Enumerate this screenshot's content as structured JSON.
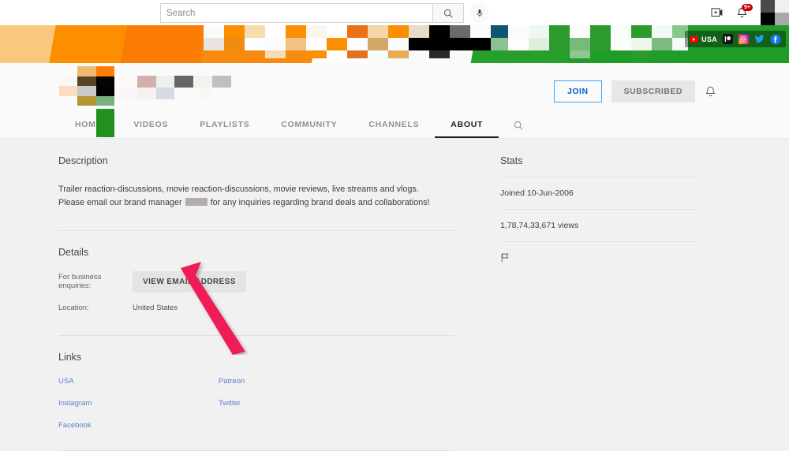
{
  "masthead": {
    "search": {
      "placeholder": "Search",
      "value": ""
    },
    "search_icon": "search-icon",
    "mic_icon": "microphone-icon",
    "create_icon": "create-video-icon",
    "notifications_icon": "notification-bell-icon",
    "notifications_badge": "9+",
    "avatar": "user-avatar-redacted"
  },
  "banner": {
    "social_links": [
      {
        "name": "youtube-usa",
        "label": "USA",
        "icon": "youtube-icon"
      },
      {
        "name": "patreon",
        "label": "",
        "icon": "patreon-icon"
      },
      {
        "name": "instagram",
        "label": "",
        "icon": "instagram-icon"
      },
      {
        "name": "twitter",
        "label": "",
        "icon": "twitter-icon"
      },
      {
        "name": "facebook",
        "label": "",
        "icon": "facebook-icon"
      }
    ]
  },
  "channel_header": {
    "avatar": "channel-avatar-redacted",
    "channel_name": "",
    "join_label": "JOIN",
    "subscribed_label": "SUBSCRIBED",
    "bell_icon": "notification-bell-icon"
  },
  "tabs": [
    {
      "label": "HOME",
      "active": false
    },
    {
      "label": "VIDEOS",
      "active": false
    },
    {
      "label": "PLAYLISTS",
      "active": false
    },
    {
      "label": "COMMUNITY",
      "active": false
    },
    {
      "label": "CHANNELS",
      "active": false
    },
    {
      "label": "ABOUT",
      "active": true
    }
  ],
  "tab_search_icon": "search-icon",
  "description": {
    "heading": "Description",
    "text_part1": "Trailer reaction-discussions, movie reaction-discussions, movie reviews, live streams and vlogs.  Please email our brand manager ",
    "text_part2": " for any inquiries regarding brand deals and collaborations!"
  },
  "details": {
    "heading": "Details",
    "business_label": "For business enquiries:",
    "view_email_label": "VIEW EMAIL ADDRESS",
    "location_label": "Location:",
    "location_value": "United States"
  },
  "links": {
    "heading": "Links",
    "items": [
      {
        "label": "USA"
      },
      {
        "label": "Patreon"
      },
      {
        "label": "Instagram"
      },
      {
        "label": "Twitter"
      },
      {
        "label": "Facebook"
      }
    ]
  },
  "stats": {
    "heading": "Stats",
    "joined": "Joined 10-Jun-2006",
    "views": "1,78,74,33,671 views",
    "report_icon": "flag-report-icon"
  },
  "annotation": {
    "arrow_color": "#ef1b55",
    "points_at": "view-email-address-button"
  },
  "colors": {
    "page_bg": "#f1f1f1",
    "header_bg": "#fafafa",
    "join_blue": "#065fd4",
    "link_blue": "#5a7fc4",
    "banner_green": "#1f9d28",
    "banner_orange": "#fd8e00"
  }
}
